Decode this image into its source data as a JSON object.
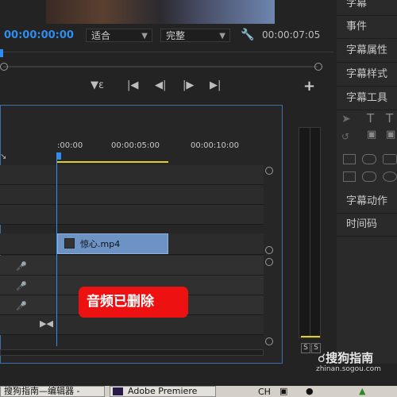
{
  "monitor": {
    "timecode_current": "00:00:00:00",
    "fit_option": "适合",
    "quality_option": "完整",
    "timecode_duration": "00:00:07:05"
  },
  "timeline": {
    "ruler_labels": [
      ":00:00",
      "00:00:05:00",
      "00:00:10:00"
    ],
    "clip_name": "惊心.mp4",
    "overlay_text": "音频已删除"
  },
  "right_panel": {
    "items": [
      "字幕",
      "事件",
      "字幕属性",
      "字幕样式",
      "字幕工具",
      "字幕动作",
      "时间码"
    ]
  },
  "meter": {
    "solo_labels": [
      "S",
      "S"
    ]
  },
  "watermark": {
    "brand": "搜狗指南",
    "url": "zhinan.sogou.com"
  },
  "taskbar": {
    "item1": "搜狗指南—编辑器 -",
    "item2": "Adobe Premiere",
    "ime": "CH"
  },
  "colors": {
    "accent_blue": "#2f8cf0",
    "clip_blue": "#6d92c4",
    "badge_red": "#ee1111",
    "work_area_yellow": "#e0d020"
  }
}
